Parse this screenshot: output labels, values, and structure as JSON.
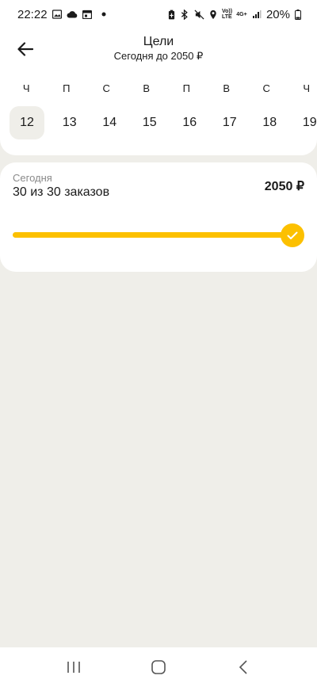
{
  "status_bar": {
    "time": "22:22",
    "battery": "20%",
    "volte_label": "Vo)) LTE",
    "network_label": "4G+"
  },
  "header": {
    "title": "Цели",
    "subtitle": "Сегодня до 2050 ₽"
  },
  "calendar": {
    "weekdays": [
      "Ч",
      "П",
      "С",
      "В",
      "П",
      "В",
      "С",
      "Ч"
    ],
    "dates": [
      "12",
      "13",
      "14",
      "15",
      "16",
      "17",
      "18",
      "19"
    ],
    "selected_date": "12"
  },
  "goal": {
    "label": "Сегодня",
    "progress_text": "30 из 30 заказов",
    "amount": "2050 ₽",
    "progress_fraction": 1.0,
    "accent_color": "#fcc000"
  },
  "icons": {
    "back": "arrow-left-icon",
    "check": "check-icon",
    "nav_recent": "recent-apps-icon",
    "nav_home": "home-icon",
    "nav_back": "back-icon"
  }
}
